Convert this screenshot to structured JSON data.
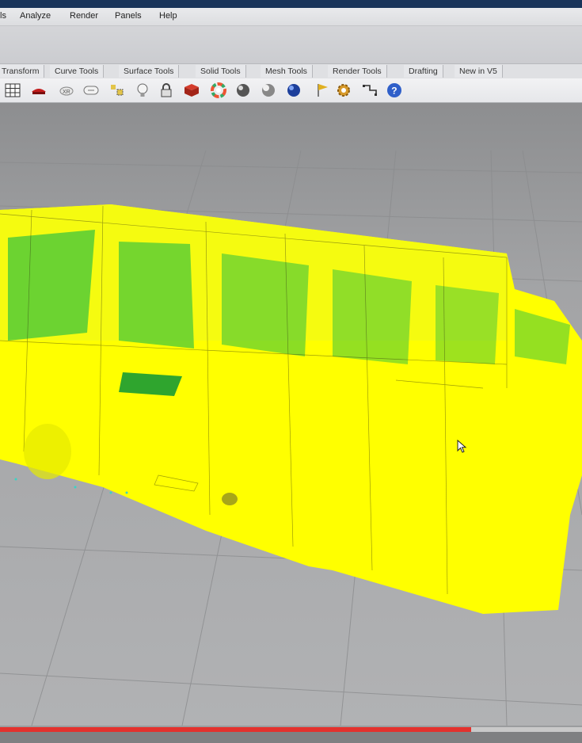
{
  "menu": {
    "items": [
      "ls",
      "Analyze",
      "Render",
      "Panels",
      "Help"
    ]
  },
  "tabs": [
    "Transform",
    "Curve Tools",
    "Surface Tools",
    "Solid Tools",
    "Mesh Tools",
    "Render Tools",
    "Drafting",
    "New in V5"
  ],
  "toolbar": {
    "icons": [
      "grid-icon",
      "red-shape-icon",
      "xray-icon",
      "capsule-icon",
      "dim-icon",
      "lightbulb-icon",
      "lock-icon",
      "book-icon",
      "color-wheel-icon",
      "sphere-icon",
      "sphere-shaded-icon",
      "sphere-blue-icon",
      "flag-icon",
      "gear-icon",
      "snap-icon",
      "help-icon"
    ]
  },
  "video": {
    "progress_fraction": 0.81
  },
  "colors": {
    "mesh_yellow": "#ffff00",
    "mesh_green": "#3ec63c",
    "title_bar": "#19345a",
    "progress_red": "#e3312d"
  }
}
